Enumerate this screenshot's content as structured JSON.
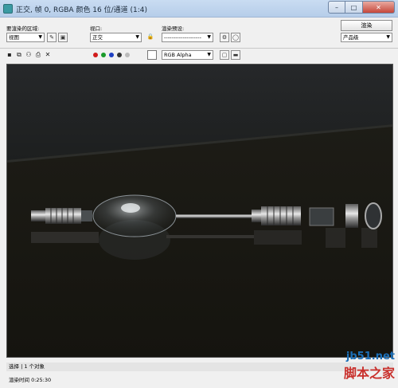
{
  "window": {
    "title": "正交, 帧 0, RGBA 颜色 16 位/通道 (1:4)",
    "min": "–",
    "max": "□",
    "close": "✕"
  },
  "area": {
    "label": "要渲染的区域:",
    "value": "视图"
  },
  "viewport": {
    "label": "视口:",
    "value": "正交"
  },
  "preset": {
    "label": "渲染预设:",
    "value": "--------------------"
  },
  "render": {
    "button": "渲染",
    "quality": "产品级"
  },
  "toolbar2": {
    "channels": [
      "red",
      "green",
      "blue",
      "alpha",
      "mono"
    ],
    "channel_colors": [
      "#d11b1b",
      "#1a9a2a",
      "#1e3fc2",
      "#333333",
      "#bbbbbb"
    ],
    "channel_select": "RGB Alpha"
  },
  "status": {
    "line1": "选择 | 1 个对象",
    "line2": "渲染时间 0:25:30"
  },
  "watermark": {
    "line1": "jb51.net",
    "line2": "脚本之家"
  }
}
